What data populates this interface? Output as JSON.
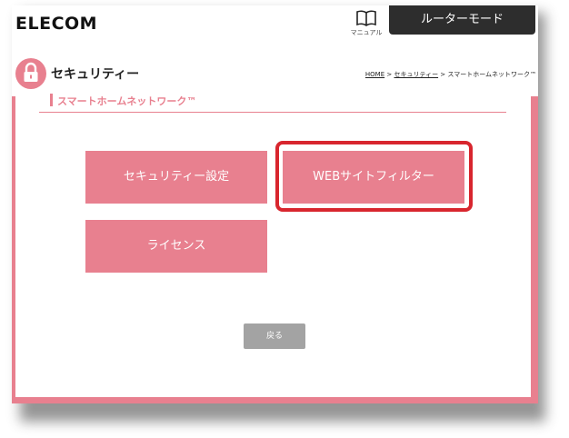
{
  "header": {
    "logo": "ELECOM",
    "manual_label": "マニュアル",
    "mode_label": "ルーターモード"
  },
  "page": {
    "title": "セキュリティー",
    "subtitle": "スマートホームネットワーク™"
  },
  "breadcrumb": {
    "home": "HOME",
    "sep1": " > ",
    "security": "セキュリティー",
    "sep2": " > ",
    "current": "スマートホームネットワーク™"
  },
  "menu": {
    "security_settings": "セキュリティー設定",
    "web_filter": "WEBサイトフィルター",
    "license": "ライセンス"
  },
  "footer": {
    "back": "戻る"
  },
  "colors": {
    "accent": "#e8808f",
    "header_dark": "#2d2d2d",
    "highlight": "#d8262e",
    "back_button": "#a3a3a3"
  },
  "icons": {
    "manual": "book-icon",
    "security": "lock-icon"
  }
}
